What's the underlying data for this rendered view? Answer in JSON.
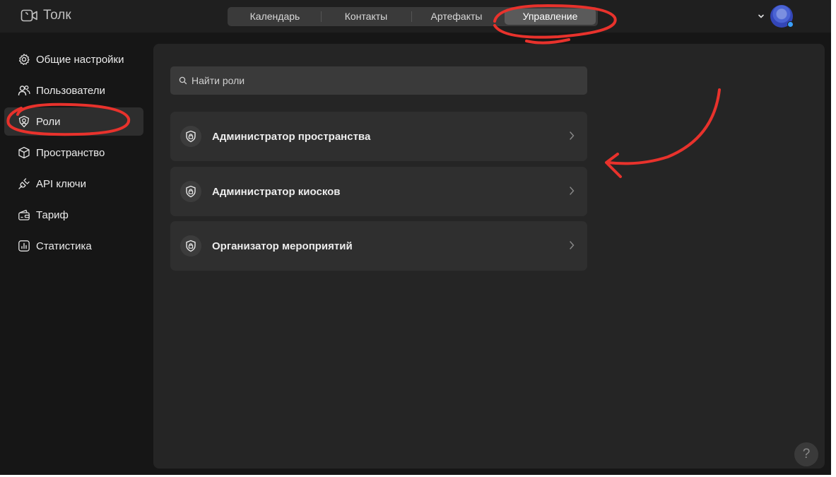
{
  "app": {
    "name": "Толк"
  },
  "nav": {
    "tabs": [
      "Календарь",
      "Контакты",
      "Артефакты",
      "Управление"
    ],
    "active": "Управление"
  },
  "sidebar": {
    "items": [
      {
        "label": "Общие настройки",
        "icon": "gear-icon"
      },
      {
        "label": "Пользователи",
        "icon": "users-icon"
      },
      {
        "label": "Роли",
        "icon": "roles-icon",
        "active": true
      },
      {
        "label": "Пространство",
        "icon": "cube-icon"
      },
      {
        "label": "API ключи",
        "icon": "plug-icon"
      },
      {
        "label": "Тариф",
        "icon": "wallet-icon"
      },
      {
        "label": "Статистика",
        "icon": "stats-icon"
      }
    ]
  },
  "search": {
    "placeholder": "Найти роли",
    "value": ""
  },
  "roles": [
    {
      "label": "Администратор пространства",
      "icon": "shield-lock-icon"
    },
    {
      "label": "Администратор киосков",
      "icon": "shield-lock-icon"
    },
    {
      "label": "Организатор мероприятий",
      "icon": "shield-lock-icon"
    }
  ],
  "help": {
    "label": "?"
  },
  "colors": {
    "background": "#161616",
    "topbar": "#1f1f1f",
    "panel": "#252525",
    "card": "#2f2f2f",
    "annotation": "#e8322c"
  }
}
